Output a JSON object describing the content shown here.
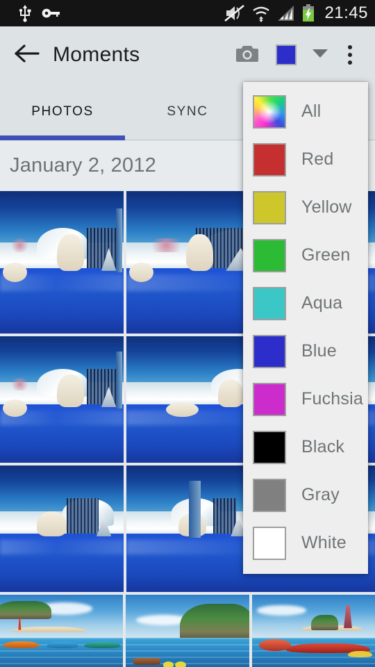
{
  "statusbar": {
    "time": "21:45",
    "icons": [
      {
        "name": "usb-icon"
      },
      {
        "name": "vpn-key-icon"
      },
      {
        "name": "mute-icon"
      },
      {
        "name": "wifi-icon"
      },
      {
        "name": "cellular-signal-icon"
      },
      {
        "name": "battery-charging-icon"
      }
    ]
  },
  "actionbar": {
    "back_icon": "arrow-back-icon",
    "title": "Moments",
    "camera_icon": "camera-icon",
    "selected_color_name": "Blue",
    "selected_color_hex": "#2d2dcc",
    "caret_icon": "chevron-down-icon",
    "overflow_icon": "overflow-menu-icon"
  },
  "tabs": {
    "items": [
      {
        "label": "PHOTOS",
        "active": true
      },
      {
        "label": "SYNC",
        "active": false
      }
    ],
    "indicator_color": "#3f51b5"
  },
  "date_header": {
    "label": "January 2, 2012"
  },
  "color_menu": {
    "items": [
      {
        "label": "All",
        "hex": "rainbow"
      },
      {
        "label": "Red",
        "hex": "#c62f2f"
      },
      {
        "label": "Yellow",
        "hex": "#cdc72c"
      },
      {
        "label": "Green",
        "hex": "#2bbb34"
      },
      {
        "label": "Aqua",
        "hex": "#3cc7c7"
      },
      {
        "label": "Blue",
        "hex": "#2d2dcc"
      },
      {
        "label": "Fuchsia",
        "hex": "#cc2ccc"
      },
      {
        "label": "Black",
        "hex": "#000000"
      },
      {
        "label": "Gray",
        "hex": "#808080"
      },
      {
        "label": "White",
        "hex": "#ffffff"
      }
    ]
  },
  "photo_grid": {
    "rows": [
      {
        "cells": [
          {
            "scene": "polar-bear",
            "alt": "Polar bears on ice by blue pool"
          },
          {
            "scene": "polar-bear",
            "alt": "Polar bears on ice by blue pool"
          },
          {
            "scene": "polar-bear",
            "alt": "Polar bears on ice by blue pool"
          }
        ]
      },
      {
        "cells": [
          {
            "scene": "polar-bear",
            "alt": "Polar bear resting on ice ledge"
          },
          {
            "scene": "polar-bear",
            "alt": "Polar bear swimming in pool"
          },
          {
            "scene": "polar-bear",
            "alt": "Polar bear swimming in pool"
          }
        ]
      },
      {
        "cells": [
          {
            "scene": "polar-bear",
            "alt": "Polar bear walking on ice"
          },
          {
            "scene": "polar-bear",
            "alt": "Polar bear walking on ice"
          },
          {
            "scene": "polar-bear",
            "alt": "Polar bear walking on ice"
          }
        ]
      },
      {
        "cells": [
          {
            "scene": "island-beach",
            "alt": "Tropical beach mural with boats"
          },
          {
            "scene": "island-cove",
            "alt": "Tropical cove with rocky shore"
          },
          {
            "scene": "island-tower",
            "alt": "Island with tower and red ride"
          }
        ]
      }
    ]
  }
}
